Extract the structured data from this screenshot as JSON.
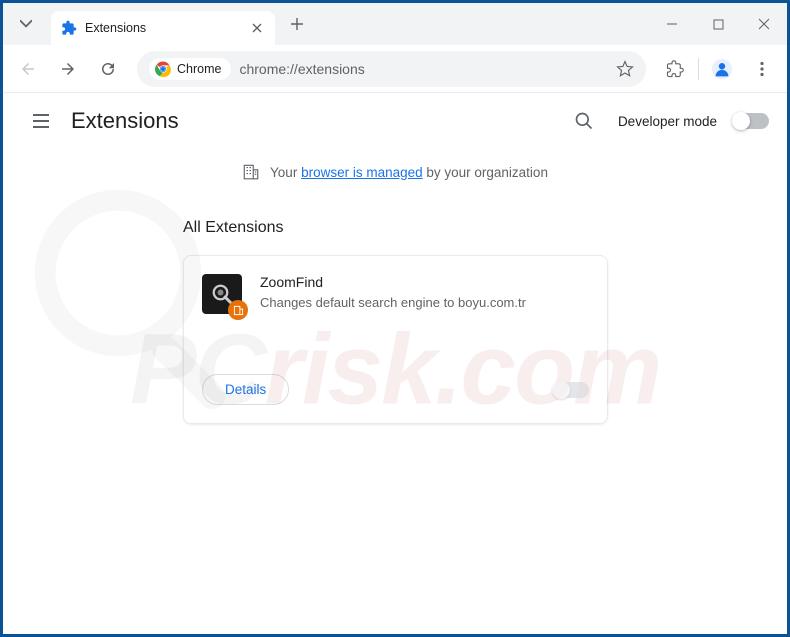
{
  "titlebar": {
    "tab_title": "Extensions"
  },
  "toolbar": {
    "chrome_label": "Chrome",
    "url": "chrome://extensions"
  },
  "header": {
    "title": "Extensions",
    "dev_mode_label": "Developer mode"
  },
  "managed": {
    "prefix": "Your ",
    "link": "browser is managed",
    "suffix": " by your organization"
  },
  "section": {
    "title": "All Extensions"
  },
  "extension": {
    "name": "ZoomFind",
    "description": "Changes default search engine to boyu.com.tr",
    "details_btn": "Details"
  },
  "watermark": {
    "pc": "PC",
    "risk": "risk.com"
  }
}
